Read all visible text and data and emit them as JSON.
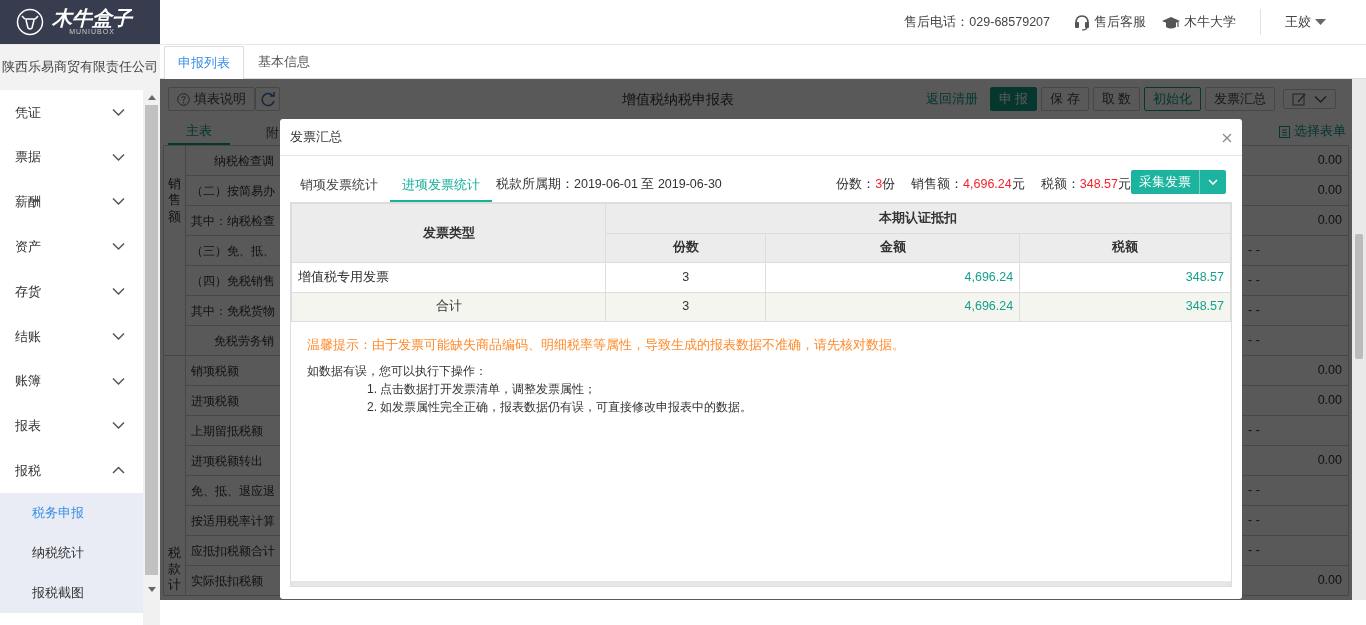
{
  "logo": {
    "name": "木牛盒子",
    "subtitle": "MUNIUBOX"
  },
  "header": {
    "phone": "售后电话：029-68579207",
    "links": [
      {
        "label": "售后客服",
        "kind": "headset"
      },
      {
        "label": "木牛大学",
        "kind": "cap"
      }
    ],
    "user": "王姣"
  },
  "sidebar": {
    "company": "陕西乐易商贸有限责任公司",
    "items": [
      {
        "label": "凭证",
        "expanded": false
      },
      {
        "label": "票据",
        "expanded": false
      },
      {
        "label": "薪酬",
        "expanded": false
      },
      {
        "label": "资产",
        "expanded": false
      },
      {
        "label": "存货",
        "expanded": false
      },
      {
        "label": "结账",
        "expanded": false
      },
      {
        "label": "账簿",
        "expanded": false
      },
      {
        "label": "报表",
        "expanded": false
      },
      {
        "label": "报税",
        "expanded": true,
        "children": [
          {
            "label": "税务申报",
            "selected": true
          },
          {
            "label": "纳税统计",
            "selected": false
          },
          {
            "label": "报税截图",
            "selected": false
          }
        ]
      }
    ]
  },
  "tabs": [
    {
      "label": "申报列表",
      "selected": true
    },
    {
      "label": "基本信息",
      "selected": false
    }
  ],
  "report": {
    "help_button": "填表说明",
    "title": "增值税纳税申报表",
    "back_link": "返回清册",
    "buttons": [
      {
        "label": "申 报",
        "kind": "primary"
      },
      {
        "label": "保 存",
        "kind": "plain"
      },
      {
        "label": "取 数",
        "kind": "plain"
      },
      {
        "label": "初始化",
        "kind": "outline"
      },
      {
        "label": "发票汇总",
        "kind": "plain"
      }
    ],
    "sheet_tabs": [
      {
        "label": "主表",
        "selected": true
      },
      {
        "label": "附",
        "selected": false
      }
    ],
    "select_form": "选择表单",
    "groups": [
      {
        "label": "销售额",
        "rows": [
          {
            "label": "纳税检查调",
            "kind": "sub",
            "value": "0.00"
          },
          {
            "label": "（二）按简易办",
            "kind": "main",
            "value": "0.00"
          },
          {
            "label": "其中：纳税检查",
            "kind": "main",
            "value": "0.00"
          },
          {
            "label": "（三）免、抵、",
            "kind": "main",
            "value": "- -"
          },
          {
            "label": "（四）免税销售",
            "kind": "main",
            "value": "- -"
          },
          {
            "label": "其中：免税货物",
            "kind": "main",
            "value": "- -"
          },
          {
            "label": "免税劳务销",
            "kind": "sub",
            "value": "- -"
          }
        ]
      },
      {
        "label": "税款计",
        "rows": [
          {
            "label": "销项税额",
            "kind": "main",
            "value": "0.00"
          },
          {
            "label": "进项税额",
            "kind": "main",
            "value": "0.00"
          },
          {
            "label": "上期留抵税额",
            "kind": "main",
            "value": "- -"
          },
          {
            "label": "进项税额转出",
            "kind": "main",
            "value": "0.00"
          },
          {
            "label": "免、抵、退应退",
            "kind": "main",
            "value": "- -"
          },
          {
            "label": "按适用税率计算",
            "kind": "main",
            "value": "- -"
          },
          {
            "label": "应抵扣税额合计",
            "kind": "main",
            "value": "- -"
          },
          {
            "label": "实际抵扣税额",
            "kind": "main",
            "value": "0.00"
          }
        ]
      }
    ]
  },
  "modal": {
    "title": "发票汇总",
    "tabs": [
      {
        "label": "销项发票统计",
        "selected": false
      },
      {
        "label": "进项发票统计",
        "selected": true
      }
    ],
    "period": "税款所属期：2019-06-01 至 2019-06-30",
    "summary": [
      {
        "label": "份数：",
        "value": "3",
        "unit": "份"
      },
      {
        "label": "销售额：",
        "value": "4,696.24",
        "unit": "元"
      },
      {
        "label": "税额：",
        "value": "348.57",
        "unit": "元"
      }
    ],
    "collect_button": "采集发票",
    "table": {
      "group_header": "本期认证抵扣",
      "columns": [
        "发票类型",
        "份数",
        "金额",
        "税额"
      ],
      "rows": [
        {
          "kind": "data",
          "cells": [
            "增值税专用发票",
            "3",
            "4,696.24",
            "348.57"
          ]
        },
        {
          "kind": "total",
          "cells": [
            "合计",
            "3",
            "4,696.24",
            "348.57"
          ]
        }
      ]
    },
    "warning": "温馨提示：由于发票可能缺失商品编码、明细税率等属性，导致生成的报表数据不准确，请先核对数据。",
    "intro": "如数据有误，您可以执行下操作：",
    "steps": [
      "1. 点击数据打开发票清单，调整发票属性；",
      "2. 如发票属性完全正确，报表数据仍有误，可直接修改申报表中的数据。"
    ]
  }
}
